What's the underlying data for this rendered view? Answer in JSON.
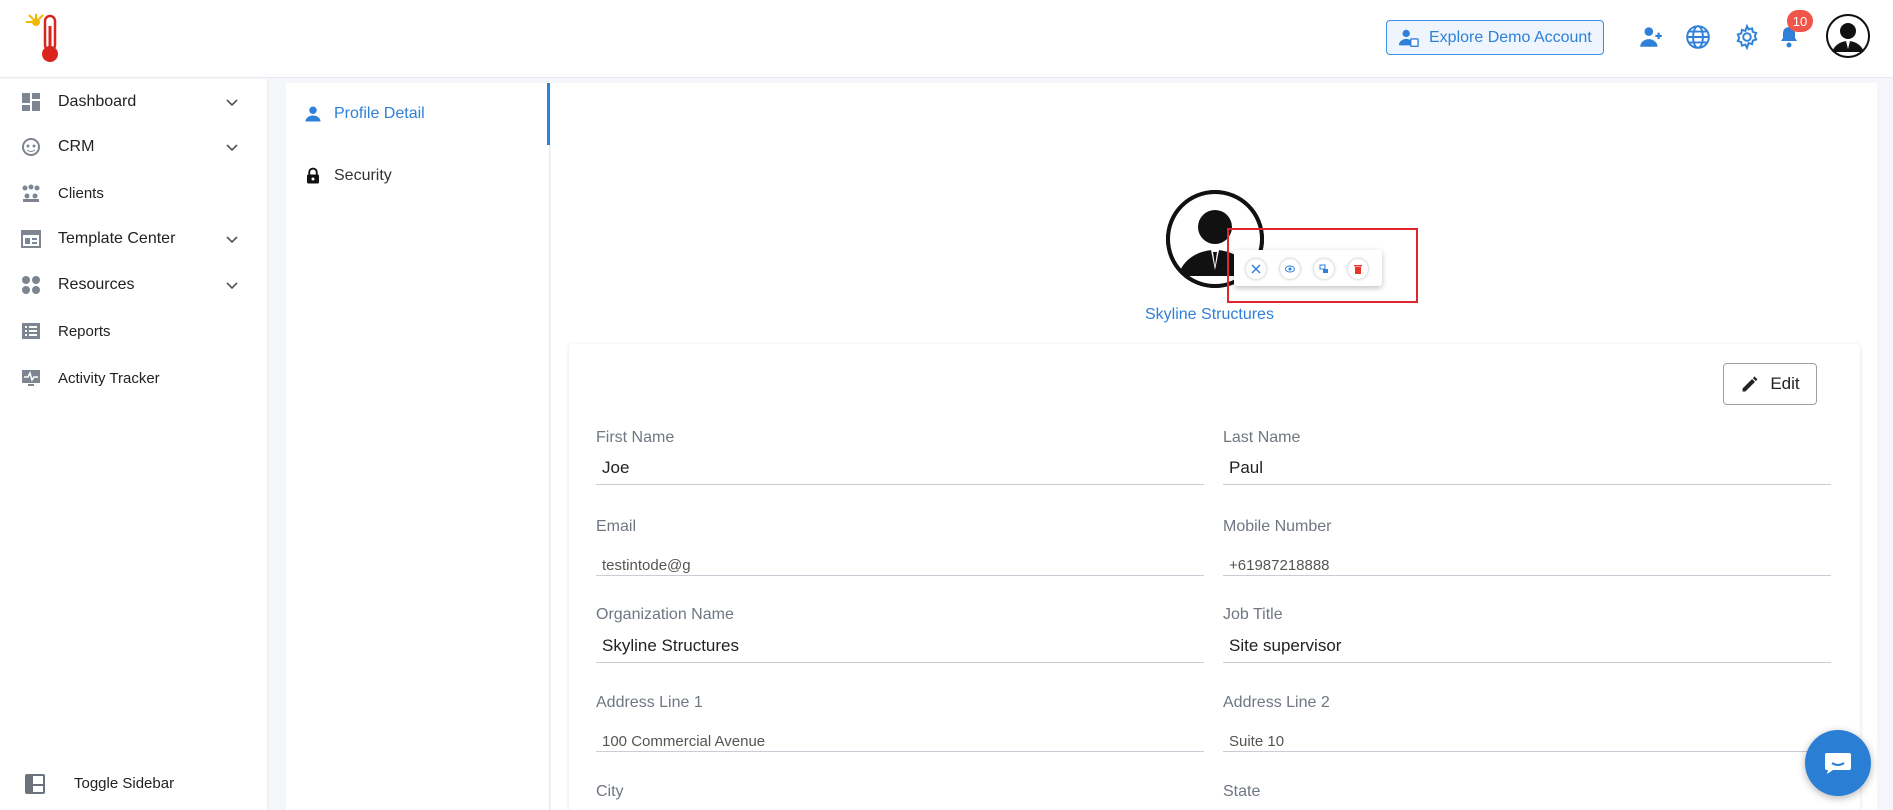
{
  "header": {
    "logo_icon": "thermometer-sun-logo",
    "demo_button_label": "Explore Demo Account",
    "notification_count": "10",
    "accent": "#2f80d8"
  },
  "sidebar": {
    "items": [
      {
        "label": "Dashboard",
        "icon": "dashboard-icon",
        "expandable": true
      },
      {
        "label": "CRM",
        "icon": "crm-icon",
        "expandable": true
      },
      {
        "label": "Clients",
        "icon": "clients-icon",
        "expandable": false
      },
      {
        "label": "Template Center",
        "icon": "template-icon",
        "expandable": true
      },
      {
        "label": "Resources",
        "icon": "resources-icon",
        "expandable": true
      },
      {
        "label": "Reports",
        "icon": "reports-icon",
        "expandable": false
      },
      {
        "label": "Activity Tracker",
        "icon": "activity-icon",
        "expandable": false
      }
    ],
    "toggle_label": "Toggle Sidebar"
  },
  "settings_tabs": {
    "profile_detail": "Profile Detail",
    "security": "Security"
  },
  "profile": {
    "display_name": "Skyline Structures",
    "edit_label": "Edit",
    "fields": {
      "first_name_label": "First Name",
      "first_name_value": "Joe",
      "last_name_label": "Last Name",
      "last_name_value": "Paul",
      "email_label": "Email",
      "email_value": "testintode@g",
      "mobile_label": "Mobile Number",
      "mobile_value": "+61987218888",
      "org_label": "Organization Name",
      "org_value": "Skyline Structures",
      "job_label": "Job Title",
      "job_value": "Site supervisor",
      "addr1_label": "Address Line 1",
      "addr1_value": "100 Commercial Avenue",
      "addr2_label": "Address Line 2",
      "addr2_value": "Suite 10",
      "city_label": "City",
      "state_label": "State"
    }
  }
}
